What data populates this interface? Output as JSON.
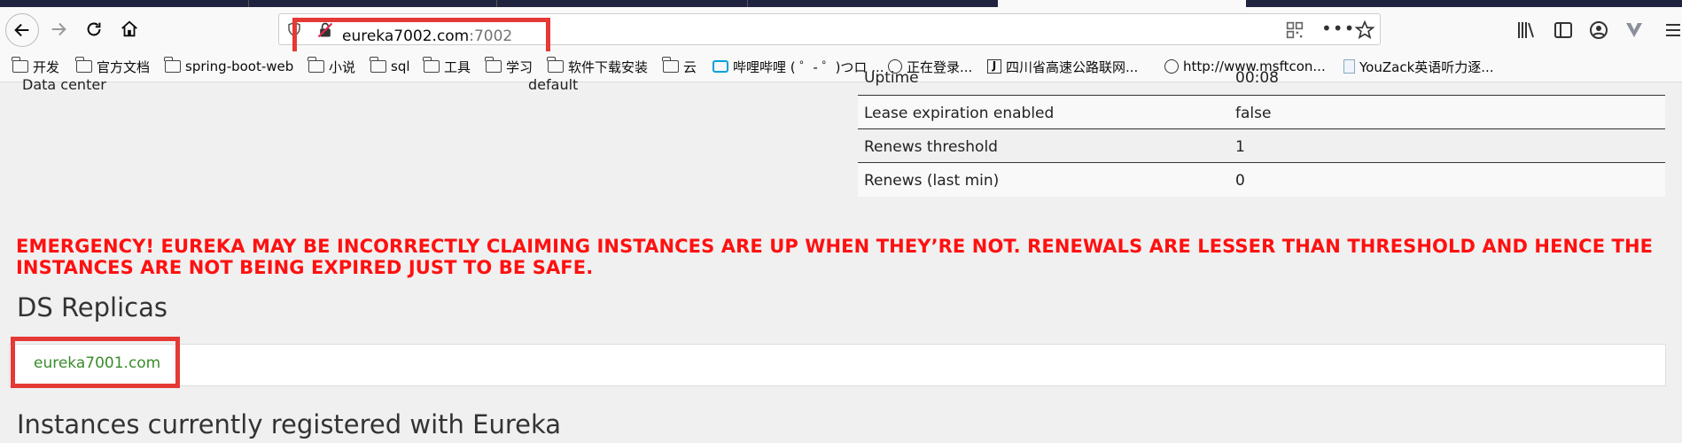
{
  "browser": {
    "url_host": "eureka7002.com",
    "url_port": ":7002"
  },
  "bookmarks": [
    {
      "label": "开发",
      "icon": "folder-icon"
    },
    {
      "label": "官方文档",
      "icon": "folder-icon"
    },
    {
      "label": "spring-boot-web",
      "icon": "folder-icon"
    },
    {
      "label": "小说",
      "icon": "folder-icon"
    },
    {
      "label": "sql",
      "icon": "folder-icon"
    },
    {
      "label": "工具",
      "icon": "folder-icon"
    },
    {
      "label": "学习",
      "icon": "folder-icon"
    },
    {
      "label": "软件下载安装",
      "icon": "folder-icon"
    },
    {
      "label": "云",
      "icon": "folder-icon"
    },
    {
      "label": "哔哩哔哩 ( ゜- ゜)つロ ...",
      "icon": "bilibili-icon"
    },
    {
      "label": "正在登录...",
      "icon": "globe-icon"
    },
    {
      "label": "四川省高速公路联网...",
      "icon": "j-site-icon"
    },
    {
      "label": "http://www.msftcon...",
      "icon": "globe-icon"
    },
    {
      "label": "YouZack英语听力逐...",
      "icon": "page-icon"
    }
  ],
  "info": {
    "left_label": "Data center",
    "left_value": "default"
  },
  "status_rows": [
    {
      "key": "Uptime",
      "value": "00:08"
    },
    {
      "key": "Lease expiration enabled",
      "value": "false"
    },
    {
      "key": "Renews threshold",
      "value": "1"
    },
    {
      "key": "Renews (last min)",
      "value": "0"
    }
  ],
  "emergency_text": "EMERGENCY! EUREKA MAY BE INCORRECTLY CLAIMING INSTANCES ARE UP WHEN THEY’RE NOT. RENEWALS ARE LESSER THAN THRESHOLD AND HENCE THE INSTANCES ARE NOT BEING EXPIRED JUST TO BE SAFE.",
  "ds_replicas_title": "DS Replicas",
  "replica_link": "eureka7001.com",
  "instances_title": "Instances currently registered with Eureka",
  "colors": {
    "emergency": "#ff1010",
    "link": "#3a8c2a",
    "highlight": "#e53935"
  }
}
